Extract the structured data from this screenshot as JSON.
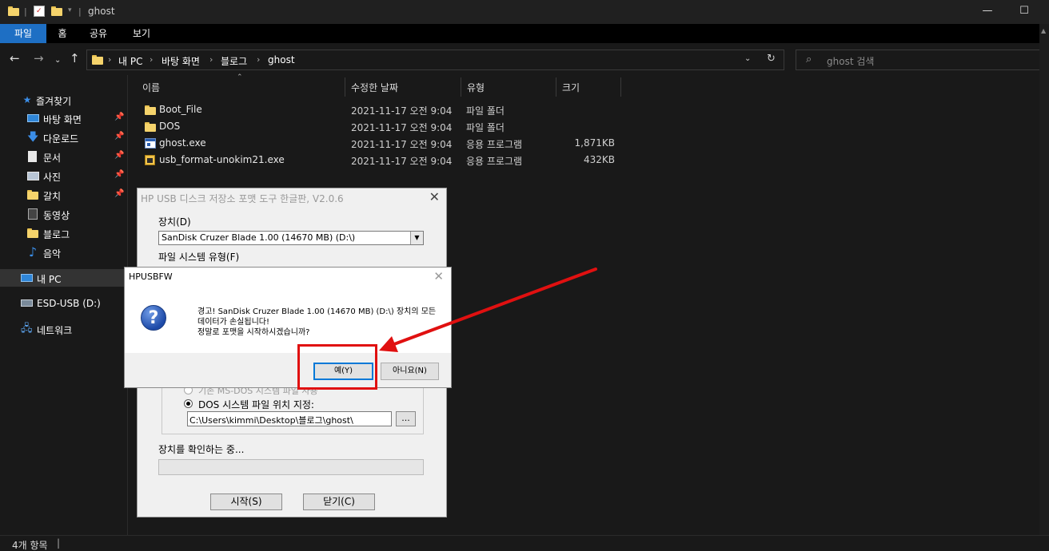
{
  "window": {
    "title": "ghost",
    "minimize_icon": "minimize-icon",
    "maximize_icon": "maximize-icon"
  },
  "ribbon": {
    "tabs": [
      "파일",
      "홈",
      "공유",
      "보기"
    ]
  },
  "address": {
    "crumbs": [
      "내 PC",
      "바탕 화면",
      "블로그",
      "ghost"
    ]
  },
  "search": {
    "placeholder": "ghost 검색"
  },
  "sidebar": {
    "items": [
      {
        "label": "즐겨찾기"
      },
      {
        "label": "바탕 화면"
      },
      {
        "label": "다운로드"
      },
      {
        "label": "문서"
      },
      {
        "label": "사진"
      },
      {
        "label": "갈치"
      },
      {
        "label": "동영상"
      },
      {
        "label": "블로그"
      },
      {
        "label": "음악"
      },
      {
        "label": "내 PC"
      },
      {
        "label": "ESD-USB (D:)"
      },
      {
        "label": "네트워크"
      }
    ]
  },
  "filelist": {
    "columns": [
      "이름",
      "수정한 날짜",
      "유형",
      "크기"
    ],
    "rows": [
      {
        "name": "Boot_File",
        "date": "2021-11-17 오전 9:04",
        "type": "파일 폴더",
        "size": ""
      },
      {
        "name": "DOS",
        "date": "2021-11-17 오전 9:04",
        "type": "파일 폴더",
        "size": ""
      },
      {
        "name": "ghost.exe",
        "date": "2021-11-17 오전 9:04",
        "type": "응용 프로그램",
        "size": "1,871KB"
      },
      {
        "name": "usb_format-unokim21.exe",
        "date": "2021-11-17 오전 9:04",
        "type": "응용 프로그램",
        "size": "432KB"
      }
    ]
  },
  "status": {
    "count": "4개 항목"
  },
  "hp_tool": {
    "title": "HP USB 디스크 저장소 포맷 도구 한글판, V2.0.6",
    "device_label": "장치(D)",
    "device_value": "SanDisk Cruzer Blade 1.00 (14670 MB) (D:\\)",
    "fs_label": "파일 시스템 유형(F)",
    "hidden_option": "기존 MS-DOS 시스템 파일 사용",
    "dos_option": "DOS 시스템 파일 위치 지정:",
    "dos_path": "C:\\Users\\kimmi\\Desktop\\블로그\\ghost\\",
    "browse": "...",
    "status": "장치를 확인하는 중...",
    "start": "시작(S)",
    "close": "닫기(C)"
  },
  "dialog": {
    "title": "HPUSBFW",
    "line1": "경고! SanDisk Cruzer Blade 1.00 (14670 MB) (D:\\) 장치의 모든",
    "line2": "데이터가 손실됩니다!",
    "line3": "정말로 포맷을 시작하시겠습니까?",
    "yes": "예(Y)",
    "no": "아니요(N)"
  },
  "annotation": {
    "color": "#e01010"
  }
}
